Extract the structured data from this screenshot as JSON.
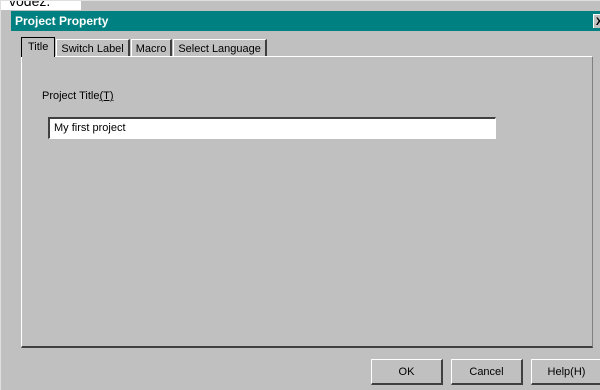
{
  "caption_fragment": "vodez.",
  "window": {
    "title": "Project Property",
    "close_label": "X"
  },
  "tabs": [
    {
      "label": "Title",
      "active": true
    },
    {
      "label": "Switch Label",
      "active": false
    },
    {
      "label": "Macro",
      "active": false
    },
    {
      "label": "Select Language",
      "active": false
    }
  ],
  "form": {
    "label_text": "Project Title",
    "label_shortcut": "(T)",
    "title_value": "My first project"
  },
  "buttons": {
    "ok": "OK",
    "cancel": "Cancel",
    "help": "Help(H)"
  }
}
